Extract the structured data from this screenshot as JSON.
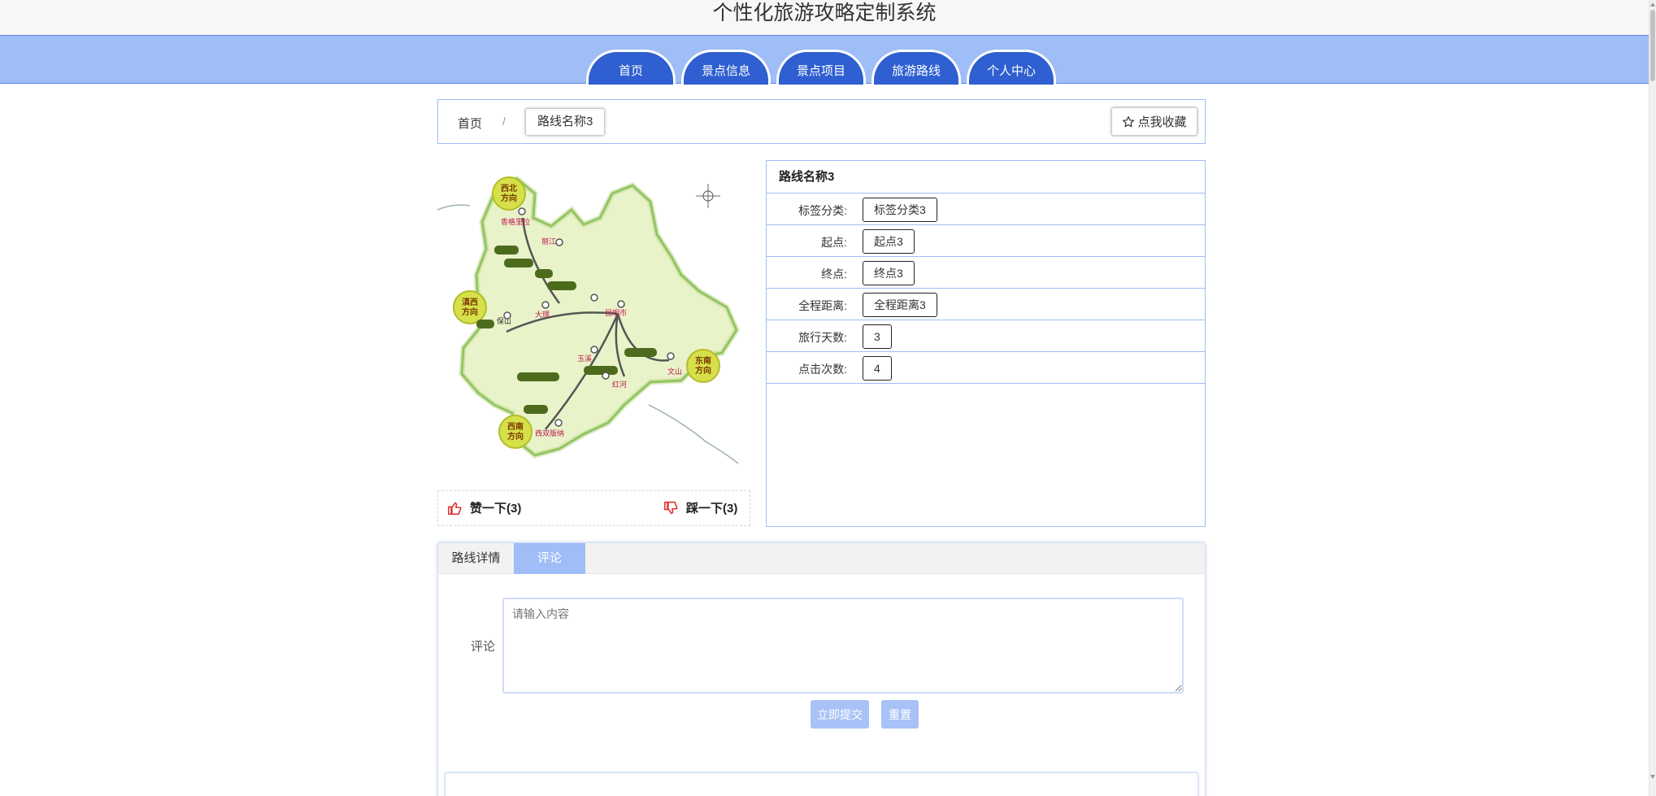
{
  "app": {
    "title": "个性化旅游攻略定制系统"
  },
  "nav": {
    "tabs": [
      "首页",
      "景点信息",
      "景点项目",
      "旅游路线",
      "个人中心"
    ]
  },
  "breadcrumb": {
    "home": "首页",
    "separator": "/",
    "current": "路线名称3",
    "favorite_label": "点我收藏"
  },
  "map": {
    "regions": [
      "西北方向",
      "滇西方向",
      "东南方向",
      "西南方向"
    ],
    "places": [
      "香格里拉",
      "昆明市",
      "大理",
      "丽江",
      "玉溪",
      "红河",
      "文山",
      "保山",
      "西双版纳"
    ]
  },
  "votes": {
    "like_label": "赞一下(3)",
    "dislike_label": "踩一下(3)"
  },
  "detail": {
    "title": "路线名称3",
    "rows": [
      {
        "label": "标签分类:",
        "value": "标签分类3"
      },
      {
        "label": "起点:",
        "value": "起点3"
      },
      {
        "label": "终点:",
        "value": "终点3"
      },
      {
        "label": "全程距离:",
        "value": "全程距离3"
      },
      {
        "label": "旅行天数:",
        "value": "3"
      },
      {
        "label": "点击次数:",
        "value": "4"
      }
    ]
  },
  "tabs": {
    "detail_label": "路线详情",
    "comment_label": "评论",
    "active": "评论"
  },
  "comment": {
    "label": "评论",
    "placeholder": "请输入内容",
    "submit_label": "立即提交",
    "reset_label": "重置"
  },
  "colors": {
    "nav_bg": "#9fbdf7",
    "nav_tab": "#2f5fd0",
    "button": "#a8c2f7",
    "border": "#9fbdf7"
  }
}
